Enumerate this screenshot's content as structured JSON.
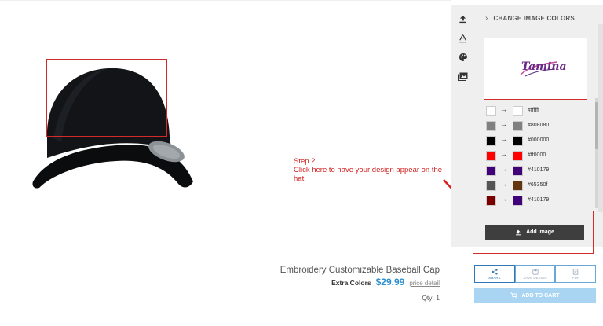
{
  "step": {
    "line1": "Step 2",
    "line2": "Click here to have your design appear on the hat"
  },
  "panel": {
    "header": "CHANGE IMAGE COLORS",
    "preview_logo_text": "Tamina",
    "colors": [
      {
        "from": "#ffffff",
        "to": "#ffffff",
        "hex": "#ffffff"
      },
      {
        "from": "#808080",
        "to": "#808080",
        "hex": "#808080"
      },
      {
        "from": "#000000",
        "to": "#000000",
        "hex": "#000000"
      },
      {
        "from": "#ff0000",
        "to": "#ff0000",
        "hex": "#ff0000"
      },
      {
        "from": "#410179",
        "to": "#410179",
        "hex": "#410179"
      },
      {
        "from": "#555555",
        "to": "#65350f",
        "hex": "#65350f"
      },
      {
        "from": "#7a0000",
        "to": "#410179",
        "hex": "#410179"
      }
    ],
    "add_image_label": "Add image"
  },
  "product": {
    "title": "Embroidery Customizable Baseball Cap",
    "extra_colors_label": "Extra Colors",
    "price": "$29.99",
    "price_detail": "price detail",
    "qty": "Qty: 1"
  },
  "actions": {
    "share": "SHARE",
    "save_design": "SAVE DESIGN",
    "pdf": "PDF",
    "add_to_cart": "ADD TO CART"
  },
  "icons": {
    "toolbar": [
      "upload-icon",
      "text-icon",
      "palette-icon",
      "images-icon"
    ]
  },
  "accent_colors": {
    "annotation_red": "#d62a2a",
    "price_blue": "#2b8ed1",
    "cart_bg": "#a9d5f3",
    "cap_color": "#111111"
  }
}
